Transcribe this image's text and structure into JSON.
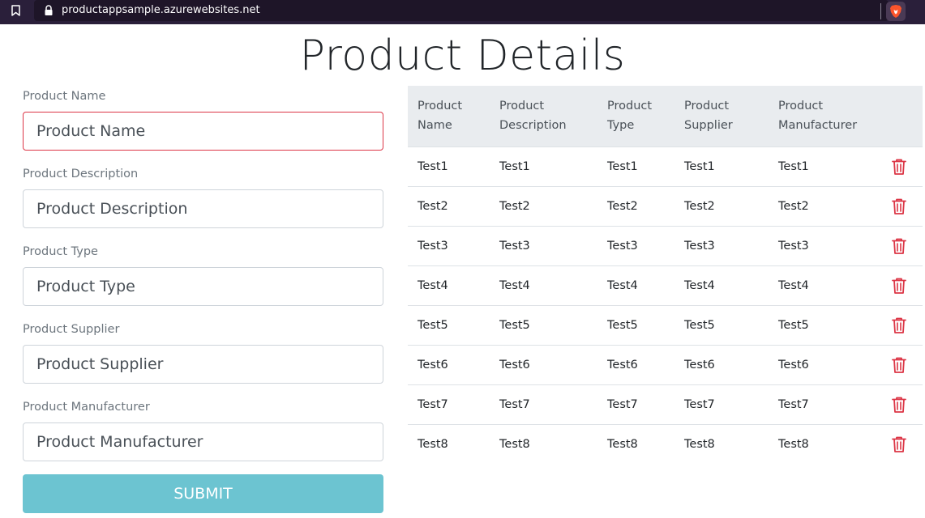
{
  "browser": {
    "url": "productappsample.azurewebsites.net",
    "icons": [
      "bookmark-icon",
      "lock-icon",
      "brave-icon"
    ]
  },
  "page": {
    "title": "Product Details"
  },
  "form": {
    "fields": [
      {
        "label": "Product Name",
        "placeholder": "Product Name",
        "value": ""
      },
      {
        "label": "Product Description",
        "placeholder": "Product Description",
        "value": ""
      },
      {
        "label": "Product Type",
        "placeholder": "Product Type",
        "value": ""
      },
      {
        "label": "Product Supplier",
        "placeholder": "Product Supplier",
        "value": ""
      },
      {
        "label": "Product Manufacturer",
        "placeholder": "Product Manufacturer",
        "value": ""
      }
    ],
    "submit_label": "SUBMIT"
  },
  "table": {
    "headers": [
      "Product Name",
      "Product Description",
      "Product Type",
      "Product Supplier",
      "Product Manufacturer"
    ],
    "rows": [
      [
        "Test1",
        "Test1",
        "Test1",
        "Test1",
        "Test1"
      ],
      [
        "Test2",
        "Test2",
        "Test2",
        "Test2",
        "Test2"
      ],
      [
        "Test3",
        "Test3",
        "Test3",
        "Test3",
        "Test3"
      ],
      [
        "Test4",
        "Test4",
        "Test4",
        "Test4",
        "Test4"
      ],
      [
        "Test5",
        "Test5",
        "Test5",
        "Test5",
        "Test5"
      ],
      [
        "Test6",
        "Test6",
        "Test6",
        "Test6",
        "Test6"
      ],
      [
        "Test7",
        "Test7",
        "Test7",
        "Test7",
        "Test7"
      ],
      [
        "Test8",
        "Test8",
        "Test8",
        "Test8",
        "Test8"
      ]
    ],
    "row_action_icon": "trash-icon"
  },
  "colors": {
    "accent": "#6cc4d1",
    "danger": "#dc3545",
    "header_bg": "#e9ecef",
    "browser_bar": "#2a1f3a"
  }
}
